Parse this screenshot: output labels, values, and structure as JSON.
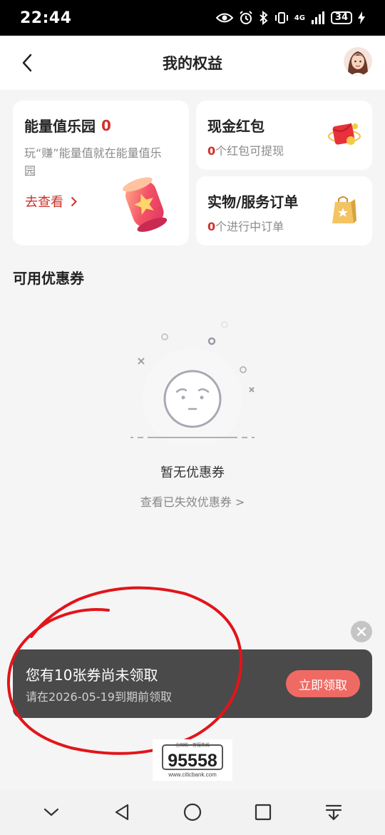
{
  "status_bar": {
    "time": "22:44",
    "battery": "34",
    "network": "4G"
  },
  "header": {
    "title": "我的权益",
    "avatar_icon": "avatar-icon"
  },
  "energy_card": {
    "title": "能量值乐园",
    "count": "0",
    "desc": "玩“赚”能量值就在能量值乐园",
    "link": "去查看",
    "image_icon": "energy-jar-icon"
  },
  "cash_card": {
    "title": "现金红包",
    "count": "0",
    "desc": "个红包可提现",
    "icon": "red-packet-icon"
  },
  "order_card": {
    "title": "实物/服务订单",
    "count": "0",
    "desc": "个进行中订单",
    "icon": "order-bag-icon"
  },
  "coupons": {
    "section_title": "可用优惠券",
    "empty_text": "暂无优惠券",
    "expired_link": "查看已失效优惠券 >"
  },
  "banner": {
    "title": "您有10张券尚未领取",
    "subtitle": "请在2026-05-19到期前领取",
    "button": "立即领取"
  },
  "hotline": {
    "caption": "全国统一客服热线",
    "number": "95558",
    "site": "www.citicbank.com"
  },
  "nav": [
    "chevron-down-icon",
    "back-triangle-icon",
    "home-circle-icon",
    "recents-square-icon",
    "notification-pull-icon"
  ],
  "colors": {
    "accent_red": "#d0312d",
    "banner_bg": "#4a4a4a",
    "banner_btn": "#f06a64"
  }
}
